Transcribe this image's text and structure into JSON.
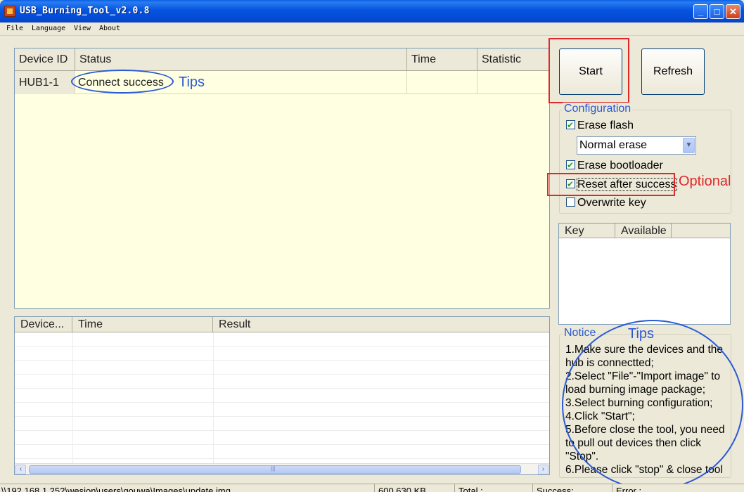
{
  "window": {
    "title": "USB_Burning_Tool_v2.0.8",
    "min_glyph": "_",
    "max_glyph": "□",
    "close_glyph": "✕"
  },
  "menu": {
    "file": "File",
    "language": "Language",
    "view": "View",
    "about": "About"
  },
  "device_grid": {
    "columns": [
      "Device ID",
      "Status",
      "Time",
      "Statistic"
    ],
    "rows": [
      {
        "device_id": "HUB1-1",
        "status": "Connect success",
        "time": "",
        "statistic": ""
      }
    ]
  },
  "log_grid": {
    "columns": [
      "Device...",
      "Time",
      "Result"
    ]
  },
  "buttons": {
    "start": "Start",
    "refresh": "Refresh"
  },
  "configuration": {
    "legend": "Configuration",
    "erase_flash": {
      "label": "Erase flash",
      "checked": true
    },
    "erase_mode": "Normal erase",
    "erase_bootloader": {
      "label": "Erase bootloader",
      "checked": true
    },
    "reset_after_success": {
      "label": "Reset after success",
      "checked": true
    },
    "overwrite_key": {
      "label": "Overwrite key",
      "checked": false
    }
  },
  "key_list": {
    "columns": [
      "Key",
      "Available"
    ]
  },
  "notice": {
    "legend": "Notice",
    "lines": [
      "1.Make sure the devices and the hub is connectted;",
      "2.Select \"File\"-\"Import image\" to load burning image package;",
      "3.Select burning configuration;",
      "4.Click \"Start\";",
      "5.Before close the tool, you need to pull out devices then click \"Stop\".",
      "6.Please click \"stop\" & close tool"
    ]
  },
  "annotations": {
    "tips_status": "Tips",
    "optional": "Optional",
    "tips_notice": "Tips"
  },
  "statusbar": {
    "path": "\\\\192.168.1.252\\wesion\\users\\gouwa\\Images\\update.img",
    "size": "600,630 KB",
    "total": "Total :",
    "success": "Success:",
    "error": "Error :"
  },
  "colors": {
    "annotation_red": "#e0282a",
    "annotation_blue": "#2a59d6",
    "grid_background": "#ffffe1"
  }
}
